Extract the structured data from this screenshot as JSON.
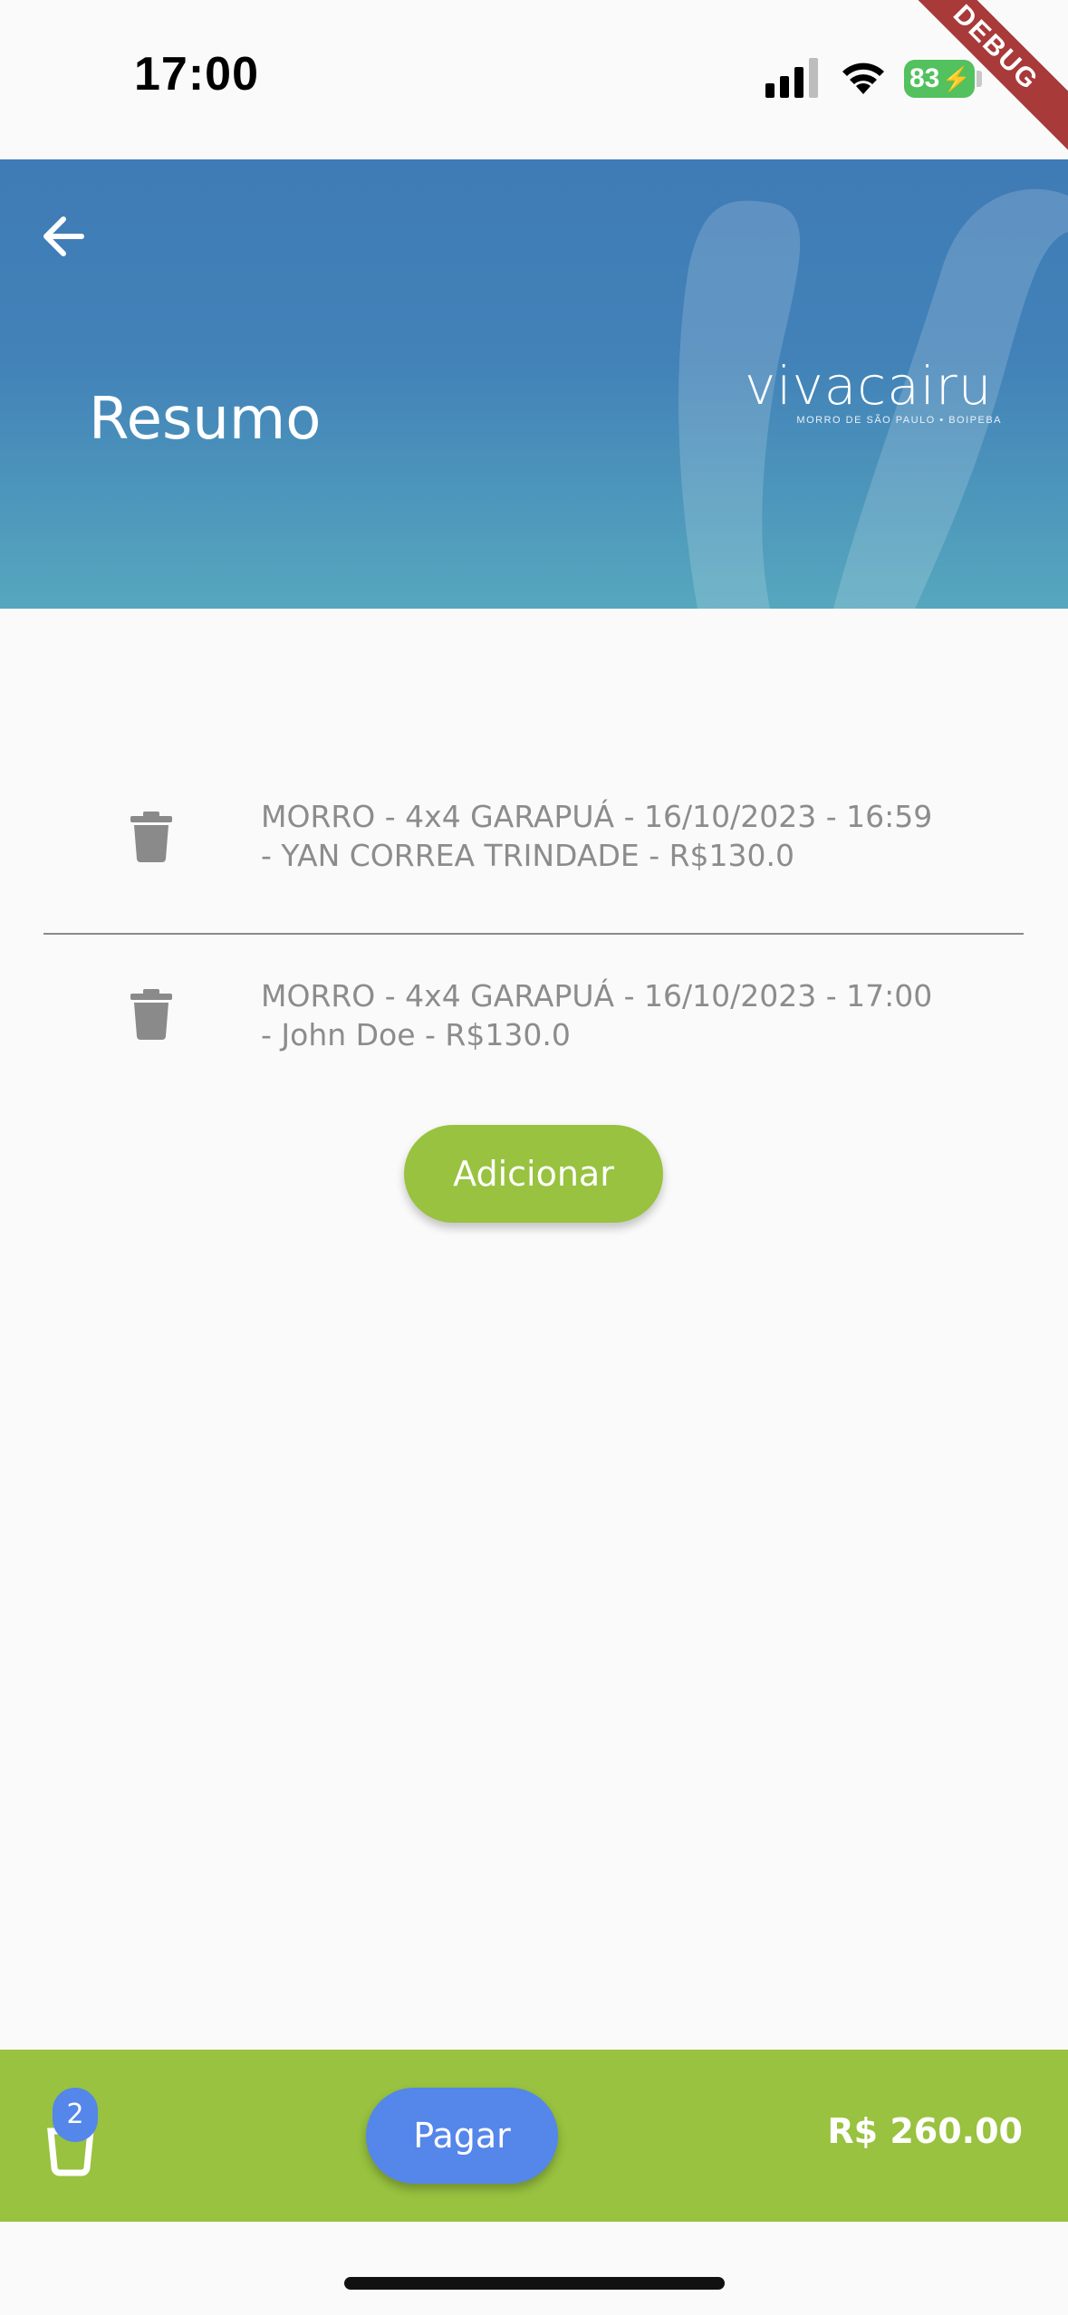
{
  "status_bar": {
    "time": "17:00",
    "battery_level": "83",
    "icons": [
      "signal-icon",
      "wifi-icon",
      "battery-charging-icon"
    ]
  },
  "debug_banner": "DEBUG",
  "header": {
    "title": "Resumo",
    "back_icon": "arrow-left-icon",
    "brand": {
      "name": "vivacairu",
      "tagline": "MORRO DE SÃO PAULO • BOIPEBA"
    }
  },
  "items": [
    {
      "line1": "MORRO - 4x4 GARAPUÁ - 16/10/2023 - 16:59",
      "line2": "- YAN CORREA TRINDADE - R$130.0",
      "delete_icon": "trash-icon"
    },
    {
      "line1": "MORRO - 4x4 GARAPUÁ - 16/10/2023 - 17:00",
      "line2": "- John Doe - R$130.0",
      "delete_icon": "trash-icon"
    }
  ],
  "actions": {
    "add_label": "Adicionar",
    "pay_label": "Pagar"
  },
  "cart": {
    "icon": "cart-icon",
    "badge_count": "2",
    "total": "R$ 260.00"
  },
  "colors": {
    "header_top": "#3f7bb6",
    "header_bottom": "#56a7be",
    "accent_green": "#98c23f",
    "accent_blue": "#5586ea",
    "item_text": "#8c8c8c",
    "debug_ribbon": "#a83a3a"
  }
}
